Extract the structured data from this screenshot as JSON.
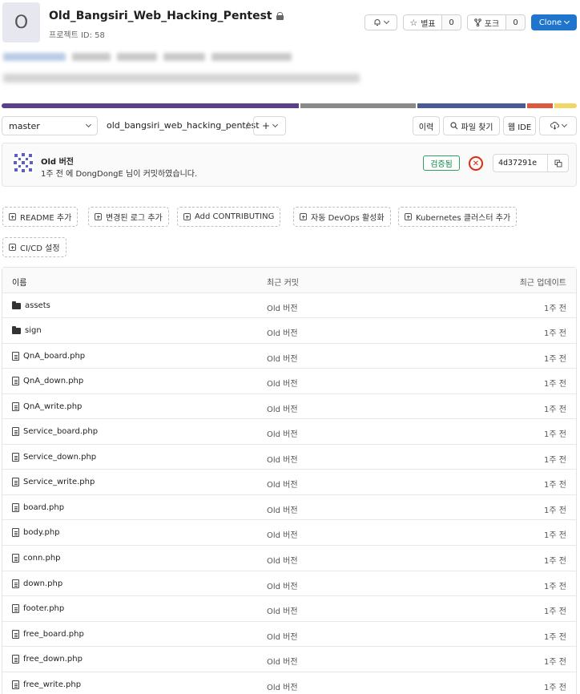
{
  "project": {
    "avatar_letter": "O",
    "title": "Old_Bangsiri_Web_Hacking_Pentest",
    "id_text": "프로젝트 ID: 58"
  },
  "header_actions": {
    "star_label": "별표",
    "star_count": "0",
    "fork_label": "포크",
    "fork_count": "0",
    "clone_label": "Clone"
  },
  "language_bar": [
    "#5b3f8a",
    "#8a8a8a",
    "#4a5a92",
    "#e0583b",
    "#f0d766"
  ],
  "nav": {
    "branch": "master",
    "breadcrumb": "old_bangsiri_web_hacking_pentest",
    "separator": "/",
    "plus": "+",
    "history": "이력",
    "find_file": "파일 찾기",
    "web_ide": "웹 IDE"
  },
  "commit": {
    "title": "Old 버전",
    "meta": "1주 전 에 DongDongE 님이 커밋하였습니다.",
    "verified": "검증됨",
    "sha": "4d37291e"
  },
  "add_buttons": [
    "README 추가",
    "변경된 로그 추가",
    "Add CONTRIBUTING",
    "자동 DevOps 활성화",
    "Kubernetes 클러스터 추가",
    "CI/CD 설정"
  ],
  "table": {
    "headers": {
      "name": "이름",
      "commit": "최근 커밋",
      "updated": "최근 업데이트"
    },
    "rows": [
      {
        "name": "assets",
        "type": "folder",
        "commit": "Old 버전",
        "updated": "1주 전"
      },
      {
        "name": "sign",
        "type": "folder",
        "commit": "Old 버전",
        "updated": "1주 전"
      },
      {
        "name": "QnA_board.php",
        "type": "file",
        "commit": "Old 버전",
        "updated": "1주 전"
      },
      {
        "name": "QnA_down.php",
        "type": "file",
        "commit": "Old 버전",
        "updated": "1주 전"
      },
      {
        "name": "QnA_write.php",
        "type": "file",
        "commit": "Old 버전",
        "updated": "1주 전"
      },
      {
        "name": "Service_board.php",
        "type": "file",
        "commit": "Old 버전",
        "updated": "1주 전"
      },
      {
        "name": "Service_down.php",
        "type": "file",
        "commit": "Old 버전",
        "updated": "1주 전"
      },
      {
        "name": "Service_write.php",
        "type": "file",
        "commit": "Old 버전",
        "updated": "1주 전"
      },
      {
        "name": "board.php",
        "type": "file",
        "commit": "Old 버전",
        "updated": "1주 전"
      },
      {
        "name": "body.php",
        "type": "file",
        "commit": "Old 버전",
        "updated": "1주 전"
      },
      {
        "name": "conn.php",
        "type": "file",
        "commit": "Old 버전",
        "updated": "1주 전"
      },
      {
        "name": "down.php",
        "type": "file",
        "commit": "Old 버전",
        "updated": "1주 전"
      },
      {
        "name": "footer.php",
        "type": "file",
        "commit": "Old 버전",
        "updated": "1주 전"
      },
      {
        "name": "free_board.php",
        "type": "file",
        "commit": "Old 버전",
        "updated": "1주 전"
      },
      {
        "name": "free_down.php",
        "type": "file",
        "commit": "Old 버전",
        "updated": "1주 전"
      },
      {
        "name": "free_write.php",
        "type": "file",
        "commit": "Old 버전",
        "updated": "1주 전"
      }
    ]
  }
}
